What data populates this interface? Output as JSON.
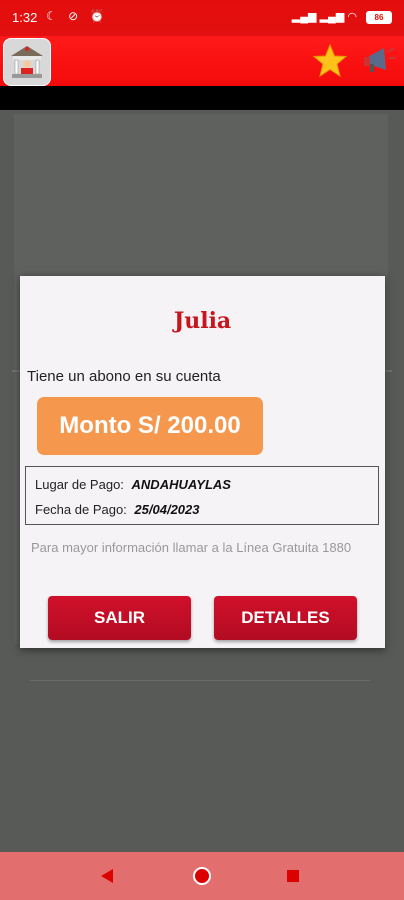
{
  "status_bar": {
    "time": "1:32",
    "battery": "86"
  },
  "app_bar": {
    "logo": "bank-building-icon",
    "favorite_icon": "star-icon",
    "announce_icon": "megaphone-icon"
  },
  "dialog": {
    "title": "Julia",
    "message": "Tiene un abono en su cuenta",
    "amount": "Monto S/ 200.00",
    "payment_place_label": "Lugar de Pago:",
    "payment_place_value": "ANDAHUAYLAS",
    "payment_date_label": "Fecha de Pago:",
    "payment_date_value": "25/04/2023",
    "note": "Para mayor información llamar a la Línea Gratuita 1880",
    "exit_button": "SALIR",
    "details_button": "DETALLES"
  },
  "colors": {
    "primary": "#e0101a",
    "amount_bg": "#f5984e",
    "button": "#c10f25"
  }
}
